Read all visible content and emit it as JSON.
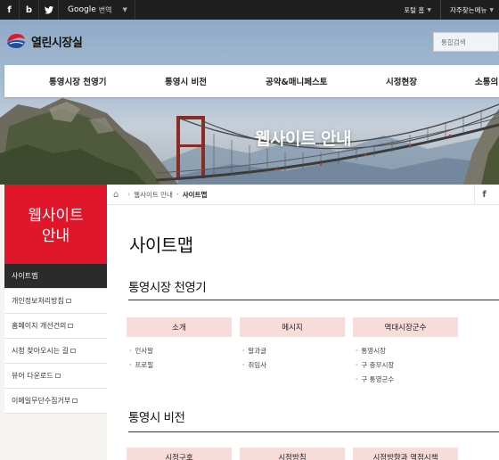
{
  "topbar": {
    "sns": [
      "f",
      "b",
      "t"
    ],
    "translate_g": "Google",
    "translate_label": "번역",
    "portal_label": "포털 홈",
    "quick_label": "자주찾는메뉴"
  },
  "header": {
    "logo_text": "열린시장실",
    "search_placeholder": "통합검색"
  },
  "gnb": [
    "통영시장 천영기",
    "통영시 비전",
    "공약&매니페스토",
    "시정현장",
    "소통의"
  ],
  "hero_title": "웹사이트 안내",
  "sidebar": {
    "title_line1": "웹사이트",
    "title_line2": "안내",
    "items": [
      {
        "label": "사이트맵",
        "active": true,
        "external": false
      },
      {
        "label": "개인정보처리방침",
        "active": false,
        "external": true
      },
      {
        "label": "홈페이지 개선건의",
        "active": false,
        "external": true
      },
      {
        "label": "시청 찾아오시는 길",
        "active": false,
        "external": true
      },
      {
        "label": "뷰어 다운로드",
        "active": false,
        "external": true
      },
      {
        "label": "이메일무단수집거부",
        "active": false,
        "external": true
      }
    ]
  },
  "breadcrumb": {
    "home_icon": "home-icon",
    "parent": "웹사이트 안내",
    "current": "사이트맵",
    "share": "f"
  },
  "page_title": "사이트맵",
  "sections": [
    {
      "title": "통영시장 천영기",
      "categories": [
        {
          "label": "소개",
          "items": [
            "인사말",
            "프로필"
          ]
        },
        {
          "label": "메시지",
          "items": [
            "말과글",
            "취임사"
          ]
        },
        {
          "label": "역대시장군수",
          "items": [
            "통영시장",
            "구 충무시장",
            "구 통영군수"
          ]
        }
      ]
    },
    {
      "title": "통영시 비전",
      "categories": [
        {
          "label": "시정구호",
          "items": []
        },
        {
          "label": "시정방침",
          "items": []
        },
        {
          "label": "시정방향과 역점시책",
          "items": []
        }
      ]
    }
  ]
}
